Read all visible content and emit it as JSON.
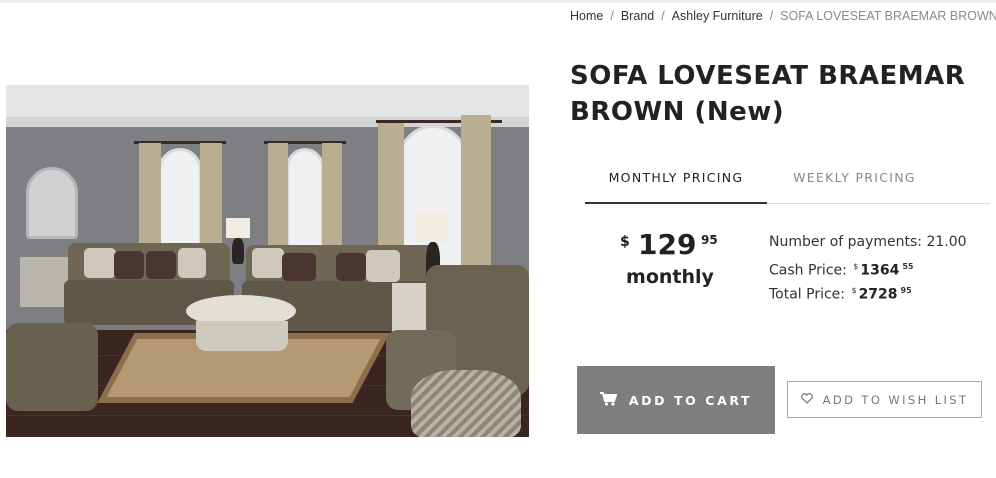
{
  "breadcrumb": {
    "items": [
      "Home",
      "Brand",
      "Ashley Furniture"
    ],
    "separator": "/",
    "current": "SOFA LOVESEAT BRAEMAR BROWN (New)"
  },
  "product": {
    "title": "SOFA LOVESEAT BRAEMAR BROWN (New)",
    "image_icon": "living-room-photo"
  },
  "pricing_tabs": {
    "monthly_label": "MONTHLY PRICING",
    "weekly_label": "WEEKLY PRICING",
    "active": "monthly"
  },
  "price": {
    "currency": "$",
    "whole": "129",
    "cents": "95",
    "unit": "monthly"
  },
  "details": {
    "payments_label": "Number of payments:",
    "payments_value": "21.00",
    "cash_label": "Cash Price:",
    "cash_currency": "$",
    "cash_whole": "1364",
    "cash_cents": "55",
    "total_label": "Total Price:",
    "total_currency": "$",
    "total_whole": "2728",
    "total_cents": "95"
  },
  "actions": {
    "add_to_cart_label": "ADD TO CART",
    "add_to_cart_icon": "cart-icon",
    "wishlist_label": "ADD TO WISH LIST",
    "wishlist_icon": "heart-icon"
  },
  "colors": {
    "cart_button": "#7d7e80",
    "text_dark": "#222222",
    "text_muted": "#888888"
  }
}
